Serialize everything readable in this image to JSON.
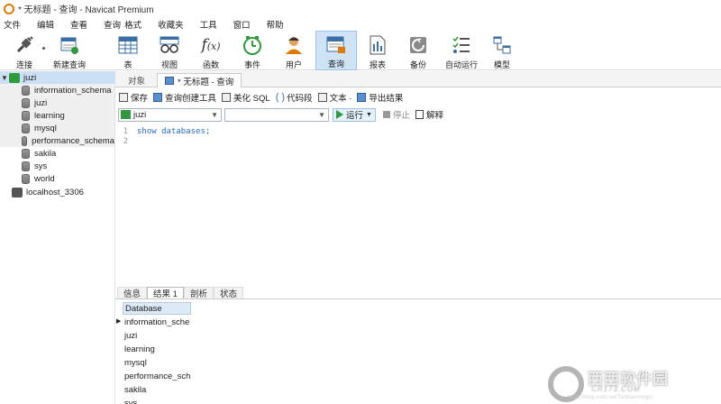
{
  "window": {
    "title": "* 无标题 - 查询 - Navicat Premium"
  },
  "menu": [
    "文件",
    "编辑",
    "查看",
    "查询",
    "格式",
    "收藏夹",
    "工具",
    "窗口",
    "帮助"
  ],
  "toolbar": {
    "connect": "连接",
    "new_query": "新建查询",
    "table": "表",
    "view": "视图",
    "function": "函数",
    "event": "事件",
    "user": "用户",
    "query": "查询",
    "report": "报表",
    "backup": "备份",
    "auto_run": "自动运行",
    "model": "模型"
  },
  "sidebar": {
    "connection": "juzi",
    "databases": [
      "information_schema",
      "juzi",
      "learning",
      "mysql",
      "performance_schema",
      "sakila",
      "sys",
      "world"
    ],
    "other_connection": "localhost_3306"
  },
  "tabs": {
    "objects": "对象",
    "current": "* 无标题 - 查询"
  },
  "query_toolbar": {
    "save": "保存",
    "query_builder": "查询创建工具",
    "beautify": "美化 SQL",
    "snippet": "代码段",
    "text": "文本 ·",
    "export": "导出结果"
  },
  "select_row": {
    "connection_value": "juzi",
    "database_value": "",
    "run": "运行",
    "stop": "停止",
    "explain": "解释"
  },
  "editor": {
    "lines": [
      {
        "num": "1",
        "text": "show databases;"
      },
      {
        "num": "2",
        "text": ""
      }
    ]
  },
  "result_tabs": [
    "信息",
    "结果 1",
    "剖析",
    "状态"
  ],
  "result_grid": {
    "column": "Database",
    "rows": [
      "information_sche",
      "juzi",
      "learning",
      "mysql",
      "performance_sch",
      "sakila",
      "sys"
    ]
  },
  "watermark": {
    "text": "西西软件园",
    "sub": "CR173.COM",
    "url": "https://blog.csdn.net/Tanbianmingju"
  }
}
